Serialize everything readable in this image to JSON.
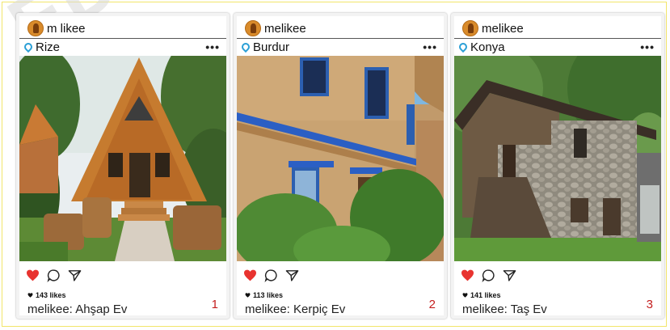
{
  "watermark": "EDI",
  "posts": [
    {
      "username": "m  likee",
      "location": "Rize",
      "more": "•••",
      "likes": "143 likes",
      "caption": "melikee: Ahşap Ev",
      "number": "1"
    },
    {
      "username": "melikee",
      "location": "Burdur",
      "more": "•••",
      "likes": "113 likes",
      "caption": "melikee: Kerpiç Ev",
      "number": "2"
    },
    {
      "username": "melikee",
      "location": "Konya",
      "more": "•••",
      "likes": "141 likes",
      "caption": "melikee: Taş Ev",
      "number": "3"
    }
  ],
  "icons": {
    "like": "heart-icon",
    "comment": "comment-icon",
    "share": "send-icon",
    "location": "location-pin-icon",
    "more": "more-dots-icon"
  },
  "colors": {
    "heart": "#e8332f",
    "pin": "#2a9fd6",
    "number": "#c41e1e"
  }
}
